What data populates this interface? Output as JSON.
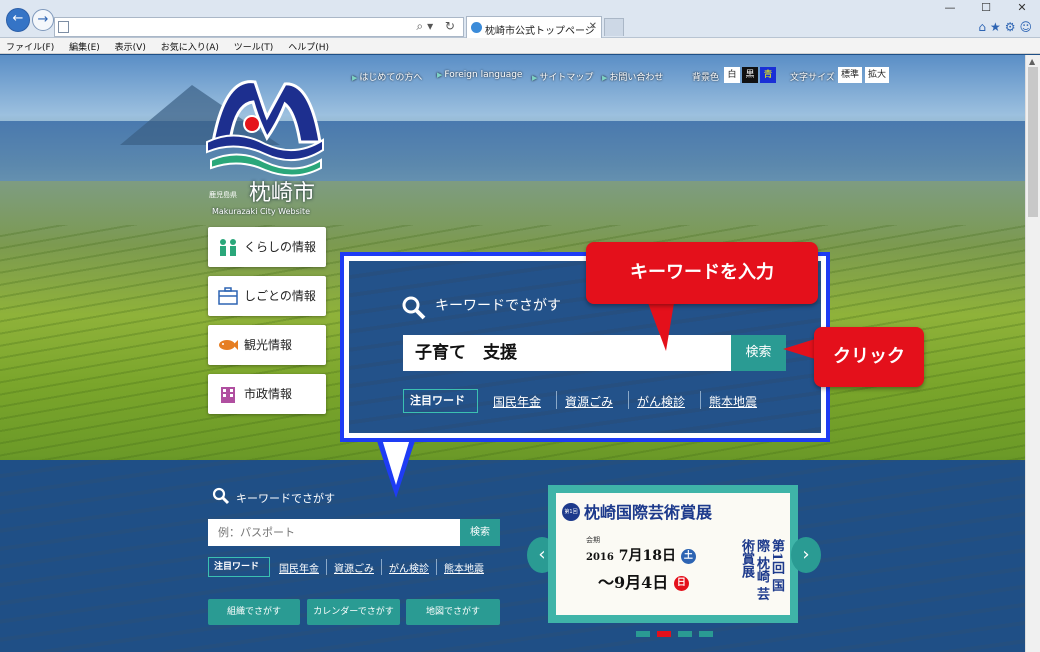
{
  "browser": {
    "tab_title": "枕崎市公式トップページ",
    "menu": [
      "ファイル(F)",
      "編集(E)",
      "表示(V)",
      "お気に入り(A)",
      "ツール(T)",
      "ヘルプ(H)"
    ],
    "window_controls": [
      "—",
      "☐",
      "✕"
    ],
    "right_icons": "⌂★⚙☺"
  },
  "utility": {
    "links": [
      "はじめての方へ",
      "Foreign language",
      "サイトマップ",
      "お問い合わせ"
    ],
    "bg_label": "背景色",
    "bg_options": [
      {
        "label": "白",
        "bg": "#ffffff",
        "fg": "#222222"
      },
      {
        "label": "黒",
        "bg": "#111111",
        "fg": "#ffffff"
      },
      {
        "label": "青",
        "bg": "#1a2fd6",
        "fg": "#ffff00"
      }
    ],
    "size_label": "文字サイズ",
    "size_options": [
      "標準",
      "拡大"
    ]
  },
  "logo": {
    "prefecture": "鹿児島県",
    "city": "枕崎市",
    "english": "Makurazaki City  Website"
  },
  "categories": [
    {
      "label": "くらしの情報",
      "icon": "people-icon"
    },
    {
      "label": "しごとの情報",
      "icon": "briefcase-icon"
    },
    {
      "label": "観光情報",
      "icon": "fish-icon"
    },
    {
      "label": "市政情報",
      "icon": "building-icon"
    }
  ],
  "callout": {
    "title": "キーワードでさがす",
    "input_value": "子育て　支援",
    "button": "検索",
    "tag": "注目ワード",
    "keywords": [
      "国民年金",
      "資源ごみ",
      "がん検診",
      "熊本地震"
    ],
    "label_keyword": "キーワードを入力",
    "label_click": "クリック"
  },
  "search": {
    "title": "キーワードでさがす",
    "placeholder": "例：パスポート",
    "button": "検索",
    "tag": "注目ワード",
    "keywords": [
      "国民年金",
      "資源ごみ",
      "がん検診",
      "熊本地震"
    ]
  },
  "bottom_buttons": [
    "組織でさがす",
    "カレンダーでさがす",
    "地図でさがす"
  ],
  "banner": {
    "badge": "第1回",
    "title": "枕崎国際芸術賞展",
    "period_label": "会期",
    "year": "2016",
    "start": "7月18日",
    "start_day": "土",
    "end": "〜9月4日",
    "end_day": "日",
    "vertical_title": "第1回 国際 枕崎 芸術賞展"
  },
  "carousel": {
    "prev": "‹",
    "next": "›",
    "dot_colors": [
      "#2a9b93",
      "#e4101b",
      "#2a9b93",
      "#2a9b93"
    ]
  }
}
